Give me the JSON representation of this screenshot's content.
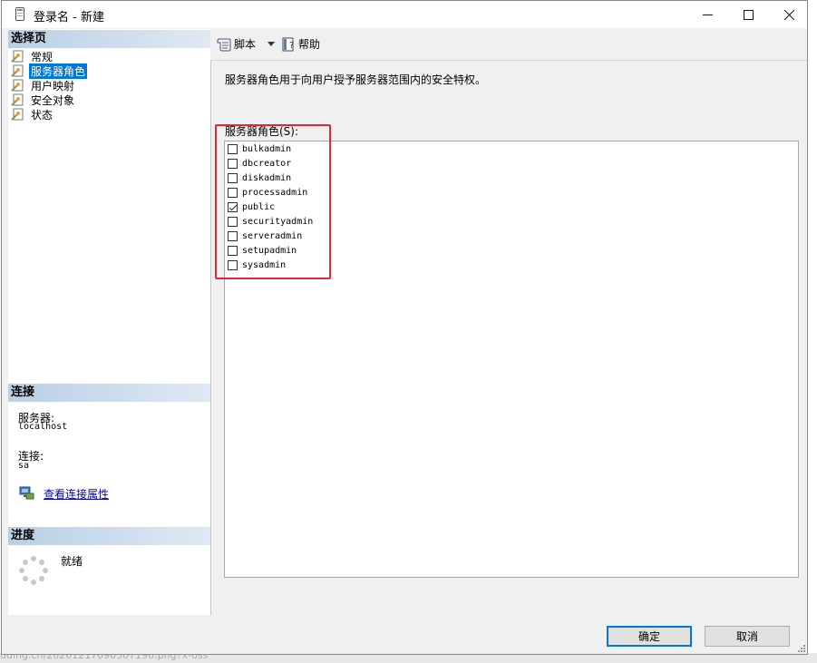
{
  "window": {
    "title": "登录名 - 新建",
    "minimize": "—",
    "maximize": "☐",
    "close": "✕"
  },
  "left_panel": {
    "select_page_header": "选择页",
    "nav_items": [
      {
        "label": "常规",
        "selected": false
      },
      {
        "label": "服务器角色",
        "selected": true
      },
      {
        "label": "用户映射",
        "selected": false
      },
      {
        "label": "安全对象",
        "selected": false
      },
      {
        "label": "状态",
        "selected": false
      }
    ],
    "connection_header": "连接",
    "server_label": "服务器:",
    "server_value": "localhost",
    "connection_label": "连接:",
    "connection_value": "sa",
    "view_connection_link": "查看连接属性",
    "progress_header": "进度",
    "progress_status": "就绪"
  },
  "toolbar": {
    "script_label": "脚本",
    "help_label": "帮助"
  },
  "main": {
    "description": "服务器角色用于向用户授予服务器范围内的安全特权。",
    "roles_label": "服务器角色(S):",
    "roles": [
      {
        "name": "bulkadmin",
        "checked": false
      },
      {
        "name": "dbcreator",
        "checked": false
      },
      {
        "name": "diskadmin",
        "checked": false
      },
      {
        "name": "processadmin",
        "checked": false
      },
      {
        "name": "public",
        "checked": true
      },
      {
        "name": "securityadmin",
        "checked": false
      },
      {
        "name": "serveradmin",
        "checked": false
      },
      {
        "name": "setupadmin",
        "checked": false
      },
      {
        "name": "sysadmin",
        "checked": false
      }
    ]
  },
  "buttons": {
    "ok": "确定",
    "cancel": "取消"
  },
  "background": {
    "bottom_text": "dding.cn/20201217090307190.png?x-oss"
  },
  "colors": {
    "accent": "#0078d7",
    "highlight_box": "#e8262b",
    "section_header": "#b9cfe4"
  }
}
